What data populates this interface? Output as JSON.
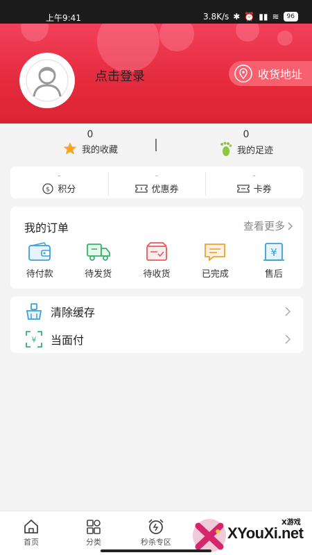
{
  "status_bar": {
    "time": "上午9:41",
    "net_speed": "3.8K/s",
    "battery": "96"
  },
  "profile": {
    "login_text": "点击登录",
    "address_button": "收货地址"
  },
  "stats": [
    {
      "count": "0",
      "label": "我的收藏",
      "icon": "star-icon"
    },
    {
      "count": "0",
      "label": "我的足迹",
      "icon": "footprint-icon"
    }
  ],
  "assets": [
    {
      "value": "-",
      "label": "积分",
      "icon": "points-icon"
    },
    {
      "value": "-",
      "label": "优惠券",
      "icon": "coupon-icon"
    },
    {
      "value": "-",
      "label": "卡券",
      "icon": "card-coupon-icon"
    }
  ],
  "orders": {
    "title": "我的订单",
    "more": "查看更多",
    "items": [
      {
        "label": "待付款",
        "icon": "wallet-icon"
      },
      {
        "label": "待发货",
        "icon": "truck-icon"
      },
      {
        "label": "待收货",
        "icon": "package-icon"
      },
      {
        "label": "已完成",
        "icon": "message-icon"
      },
      {
        "label": "售后",
        "icon": "yen-icon"
      }
    ]
  },
  "tools": [
    {
      "label": "清除缓存",
      "icon": "broom-icon"
    },
    {
      "label": "当面付",
      "icon": "scan-pay-icon"
    }
  ],
  "tabs": [
    {
      "label": "首页",
      "icon": "home-icon"
    },
    {
      "label": "分类",
      "icon": "category-icon"
    },
    {
      "label": "秒杀专区",
      "icon": "alarm-icon"
    }
  ],
  "watermark": {
    "name": "XYouXi.net",
    "tag": "X游戏"
  },
  "colors": {
    "header_red": "#e42a3c",
    "accent_orange": "#f5a623",
    "green": "#8dc63f"
  }
}
